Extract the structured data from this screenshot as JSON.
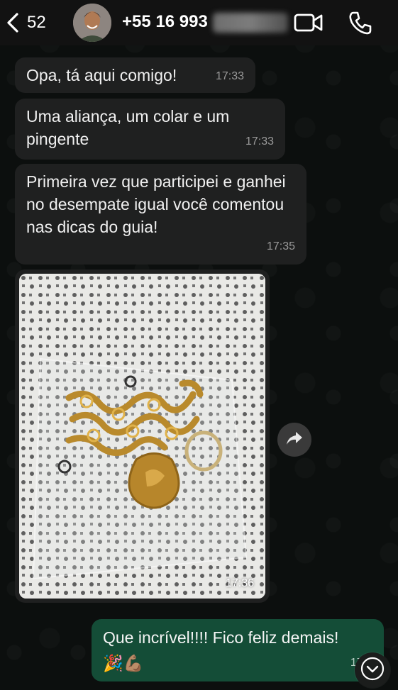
{
  "header": {
    "back_count": "52",
    "contact_name": "+55 16 993",
    "icons": {
      "back": "chevron-left-icon",
      "video": "video-camera-icon",
      "phone": "phone-icon"
    }
  },
  "messages": [
    {
      "text": "Opa, tá aqui comigo!",
      "time": "17:33"
    },
    {
      "text": "Uma aliança, um colar e um pingente",
      "time": "17:33"
    },
    {
      "text": "Primeira vez que participei e ganhei no desempate igual você comentou nas dicas do guia!",
      "time": "17:35"
    }
  ],
  "image_message": {
    "time": "17:36"
  },
  "outgoing": {
    "text": "Que incrível!!!! Fico feliz demais!",
    "emojis": "🎉💪🏽",
    "time": "17:3"
  },
  "colors": {
    "incoming_bubble": "#1f2020",
    "outgoing_bubble": "#144d37",
    "background": "#0c0f0e"
  }
}
